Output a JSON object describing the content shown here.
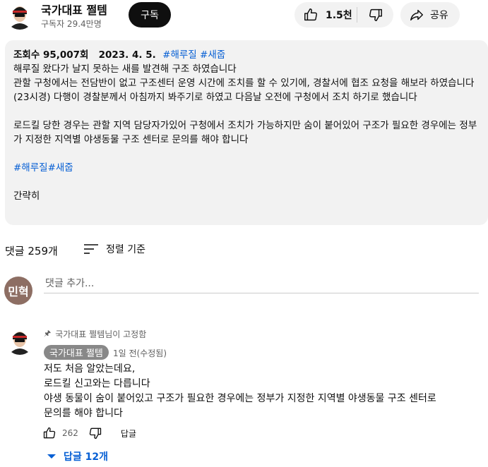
{
  "channel": {
    "name": "국가대표 쩔템",
    "subscribers": "구독자 29.4만명",
    "subscribe_label": "구독"
  },
  "actions": {
    "like_count": "1.5천",
    "share_label": "공유"
  },
  "description": {
    "views": "조회수 95,007회",
    "date": "2023. 4. 5.",
    "hashtags": "#해루질 #새줍",
    "line1": "해루질 왔다가 날지 못하는 새를 발견해 구조 하였습니다",
    "para1": "관할 구청에서는 전담반이 없고 구조센터 운영 시간에 조치를 할 수 있기에, 경찰서에 협조 요청을 해보라 하였습니다(23시경) 다행이 경찰분께서 아침까지 봐주기로 하였고 다음날 오전에 구청에서 조치 하기로 했습니다",
    "para2": "로드킬 당한 경우는 관할 지역 담당자가있어 구청에서 조치가 가능하지만 숨이 붙어있어 구조가 필요한 경우에는 정부가 지정한 지역별 야생동물 구조 센터로 문의를 해야 합니다",
    "tag_line": "#해루질#새줍",
    "collapse_label": "간략히"
  },
  "comments": {
    "count_label": "댓글 259개",
    "sort_label": "정렬 기준",
    "add_placeholder": "댓글 추가...",
    "me_initials": "민혁",
    "pinned": {
      "pinned_by": "국가대표 쩔템님이 고정함",
      "author": "국가대표 쩔템",
      "time": "1일 전(수정됨)",
      "lines": [
        "저도 처음 알았는데요,",
        "로드킬 신고와는 다릅니다",
        "야생 동물이 숨이 붙어있고 구조가 필요한 경우에는 정부가 지정한 지역별 야생동물 구조 센터로",
        "문의를 해야 합니다"
      ],
      "likes": "262",
      "reply_label": "답글",
      "replies_label": "답글 12개"
    }
  },
  "colors": {
    "link_blue": "#065fd4",
    "pill_bg": "#f2f2f2",
    "subscribe_bg": "#0f0f0f",
    "me_avatar": "#8d6e63"
  },
  "icons": [
    "thumbs-up-icon",
    "thumbs-down-icon",
    "share-icon",
    "sort-icon",
    "pin-icon",
    "chevron-down-icon"
  ]
}
